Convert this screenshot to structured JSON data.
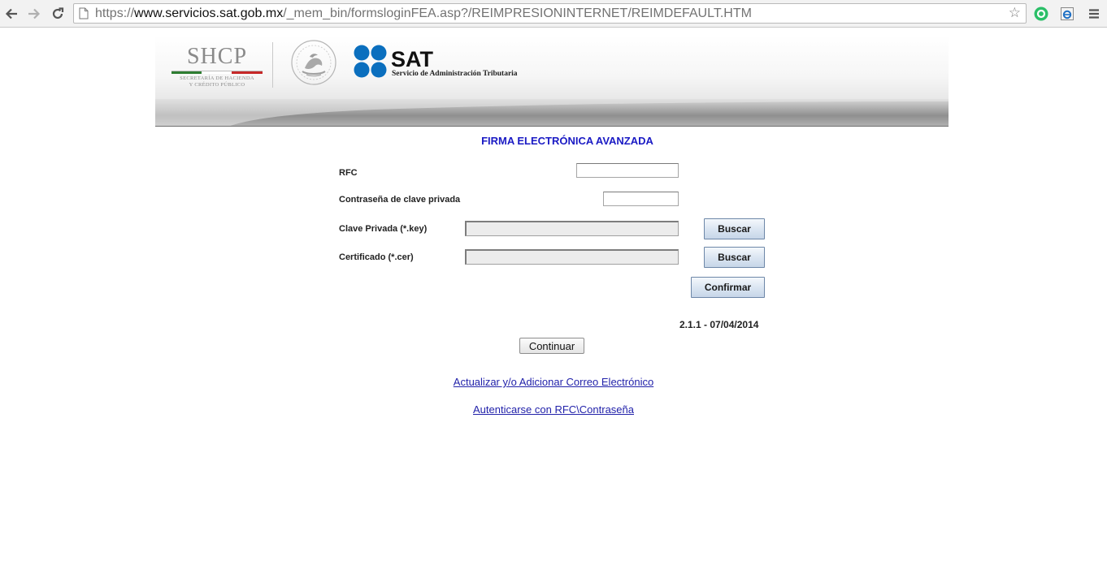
{
  "browser": {
    "url_scheme": "https://",
    "url_host": "www.servicios.sat.gob.mx",
    "url_path": "/_mem_bin/formsloginFEA.asp?/REIMPRESIONINTERNET/REIMDEFAULT.HTM",
    "icons": [
      "back-icon",
      "forward-icon",
      "reload-icon",
      "page-icon",
      "star-icon",
      "extension-icon",
      "menu-icon"
    ]
  },
  "banner": {
    "shcp_title": "SHCP",
    "shcp_subtitle_1": "SECRETARÍA DE HACIENDA",
    "shcp_subtitle_2": "Y CRÉDITO PÚBLICO",
    "sat_title": "SAT",
    "sat_subtitle": "Servicio de Administración Tributaria",
    "colors": {
      "sat_blue": "#0b6fbe",
      "shcp_grey": "#8a8a8a"
    }
  },
  "form": {
    "title": "FIRMA ELECTRÓNICA AVANZADA",
    "rfc_label": "RFC",
    "rfc_value": "",
    "password_label": "Contraseña de clave privada",
    "password_value": "",
    "key_label": "Clave Privada (*.key)",
    "key_value": "",
    "cert_label": "Certificado (*.cer)",
    "cert_value": "",
    "search_key_button": "Buscar",
    "search_cert_button": "Buscar",
    "confirm_button": "Confirmar",
    "version": "2.1.1 - 07/04/2014",
    "continue_button": "Continuar",
    "title_color": "#1a1ac4"
  },
  "links": {
    "update_email": "Actualizar y/o Adicionar Correo Electrónico",
    "auth_rfc": "Autenticarse con RFC\\Contraseña"
  }
}
